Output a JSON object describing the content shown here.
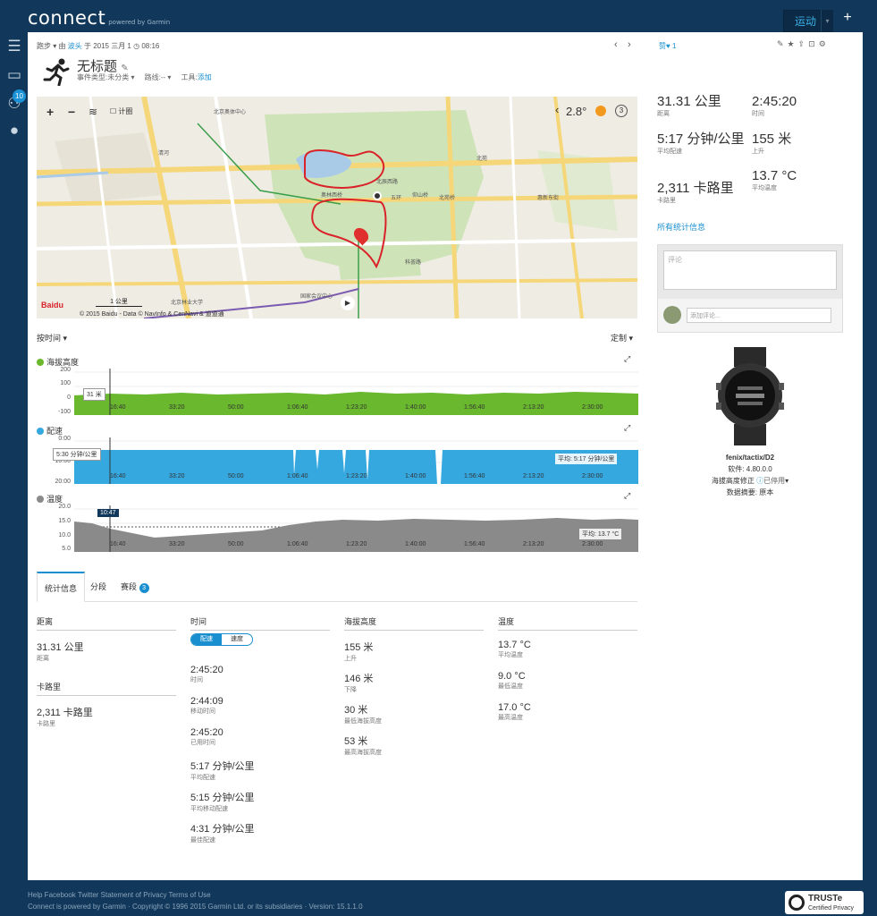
{
  "topbar": {
    "logo": "connect",
    "logo_sub": "powered by Garmin",
    "sport_label": "运动",
    "sport_caret": "▾",
    "add_label": "+"
  },
  "sidebar": {
    "badge": "10"
  },
  "activity": {
    "type": "跑步",
    "by": "由",
    "user": "波头",
    "on": "于",
    "date": "2015 三月 1",
    "time": "08:16",
    "title": "无标题",
    "event_type_label": "事件类型:",
    "event_type_value": "未分类",
    "route_label": "路线:",
    "route_value": "--",
    "tools_label": "工具:",
    "tools_value": "添加",
    "like_label": "赞",
    "like_count": "1"
  },
  "map": {
    "zoom_in": "+",
    "zoom_out": "−",
    "counter_label": "计圈",
    "weather_temp": "2.8°",
    "weather_num": "3",
    "scale": "1 公里",
    "copyright": "© 2015 Baidu - Data © NavInfo & CenNavi & 道道通",
    "baidu": "Baidu",
    "labels": [
      "北京奥体中心",
      "奥林西桥",
      "五环",
      "仰山桥",
      "北苑桥",
      "科荟路",
      "清河",
      "北苑",
      "北辰西路",
      "惠新东街",
      "北京林业大学",
      "国家会议中心"
    ]
  },
  "chart_controls": {
    "x_mode": "按时间",
    "customize": "定制"
  },
  "charts": {
    "elevation": {
      "title": "海拔高度",
      "color": "#6ab82e",
      "y_ticks": [
        "200",
        "100",
        "0",
        "-100"
      ],
      "x_ticks": [
        "16:40",
        "33:20",
        "50:00",
        "1:06:40",
        "1:23:20",
        "1:40:00",
        "1:56:40",
        "2:13:20",
        "2:30:00"
      ],
      "marker": "31 米"
    },
    "pace": {
      "title": "配速",
      "color": "#35a8e0",
      "y_ticks": [
        "0:00",
        "10:00",
        "20:00"
      ],
      "x_ticks": [
        "16:40",
        "33:20",
        "50:00",
        "1:06:40",
        "1:23:20",
        "1:40:00",
        "1:56:40",
        "2:13:20",
        "2:30:00"
      ],
      "marker": "5:30 分钟/公里",
      "avg": "平均: 5:17 分钟/公里"
    },
    "temperature": {
      "title": "温度",
      "color": "#8a8a8a",
      "y_ticks": [
        "20.0",
        "15.0",
        "10.0",
        "5.0"
      ],
      "x_ticks": [
        "16:40",
        "33:20",
        "50:00",
        "1:06:40",
        "1:23:20",
        "1:40:00",
        "1:56:40",
        "2:13:20",
        "2:30:00"
      ],
      "marker": "10:47",
      "avg": "平均: 13.7 °C"
    }
  },
  "tabs": {
    "stats": "统计信息",
    "laps": "分段",
    "segments": "赛段",
    "segments_count": "3"
  },
  "stats": {
    "distance": {
      "header": "距离",
      "value": "31.31 公里",
      "label": "距离"
    },
    "calories": {
      "header": "卡路里",
      "value": "2,311 卡路里",
      "label": "卡路里"
    },
    "time": {
      "header": "时间",
      "toggle_pace": "配速",
      "toggle_speed": "速度",
      "items": [
        {
          "value": "2:45:20",
          "label": "时间"
        },
        {
          "value": "2:44:09",
          "label": "移动时间"
        },
        {
          "value": "2:45:20",
          "label": "已用时间"
        },
        {
          "value": "5:17 分钟/公里",
          "label": "平均配速"
        },
        {
          "value": "5:15 分钟/公里",
          "label": "平均移动配速"
        },
        {
          "value": "4:31 分钟/公里",
          "label": "最佳配速"
        }
      ]
    },
    "elevation": {
      "header": "海拔高度",
      "items": [
        {
          "value": "155 米",
          "label": "上升"
        },
        {
          "value": "146 米",
          "label": "下降"
        },
        {
          "value": "30 米",
          "label": "最低海拔高度"
        },
        {
          "value": "53 米",
          "label": "最高海拔高度"
        }
      ]
    },
    "temperature": {
      "header": "温度",
      "items": [
        {
          "value": "13.7 °C",
          "label": "平均温度"
        },
        {
          "value": "9.0 °C",
          "label": "最低温度"
        },
        {
          "value": "17.0 °C",
          "label": "最高温度"
        }
      ]
    }
  },
  "summary": {
    "distance": {
      "value": "31.31 公里",
      "label": "距离"
    },
    "time": {
      "value": "2:45:20",
      "label": "时间"
    },
    "pace": {
      "value": "5:17 分钟/公里",
      "label": "平均配速"
    },
    "ascent": {
      "value": "155 米",
      "label": "上升"
    },
    "calories": {
      "value": "2,311 卡路里",
      "label": "卡路里"
    },
    "temp": {
      "value": "13.7 °C",
      "label": "平均温度"
    },
    "all_stats_link": "所有统计信息"
  },
  "comments": {
    "placeholder": "评论",
    "add_placeholder": "添加评论..."
  },
  "device": {
    "name": "fenix/tactix/D2",
    "software_label": "软件:",
    "software_value": "4.80.0.0",
    "elev_corr_label": "海拔高度修正",
    "elev_corr_value": "已停用",
    "data_label": "数据摘要:",
    "data_value": "原本"
  },
  "footer": {
    "links": "Help Facebook Twitter Statement of Privacy Terms of Use",
    "copyright": "Connect is powered by Garmin · Copyright © 1996 2015 Garmin Ltd. or its subsidiaries · Version: 15.1.1.0",
    "truste": "TRUSTe",
    "truste_sub": "Certified Privacy"
  }
}
